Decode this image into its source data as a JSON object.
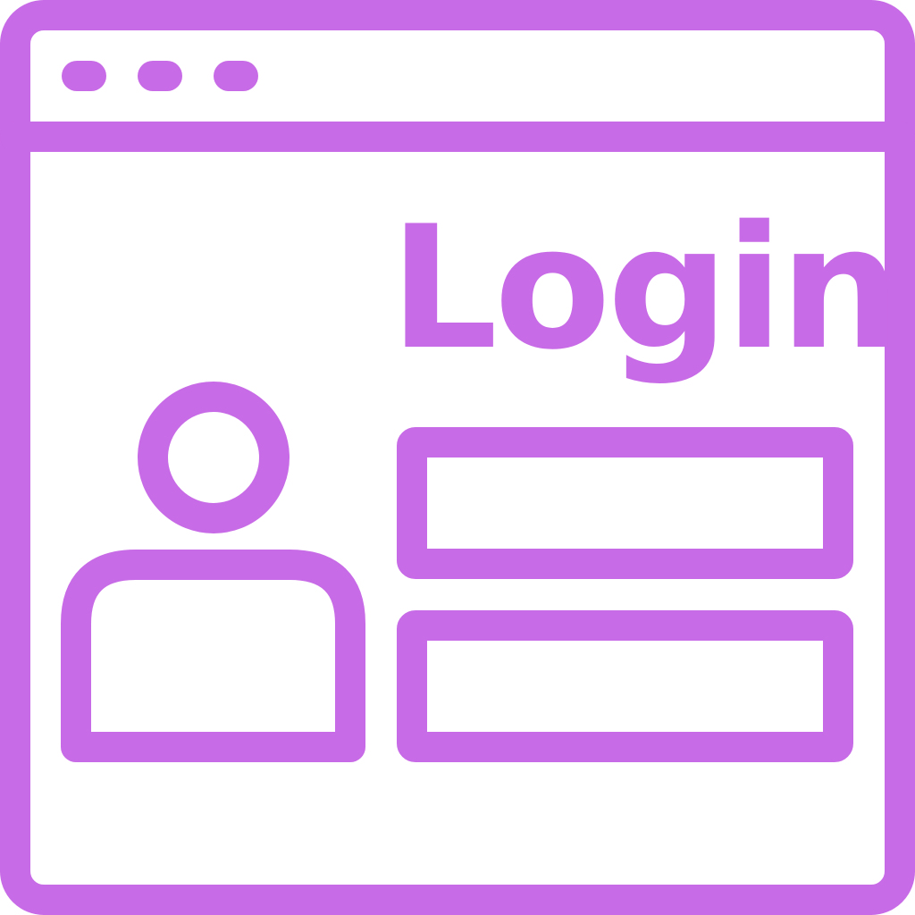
{
  "icon": {
    "name": "browser-login-icon",
    "stroke_color": "#C86BE6",
    "background_color": "#FFFFFF"
  },
  "title_bar": {
    "dots": [
      "dot-1",
      "dot-2",
      "dot-3"
    ]
  },
  "login": {
    "title": "Login"
  },
  "avatar": {
    "icon": "user-icon"
  },
  "form": {
    "fields": [
      "username-field",
      "password-field"
    ]
  }
}
